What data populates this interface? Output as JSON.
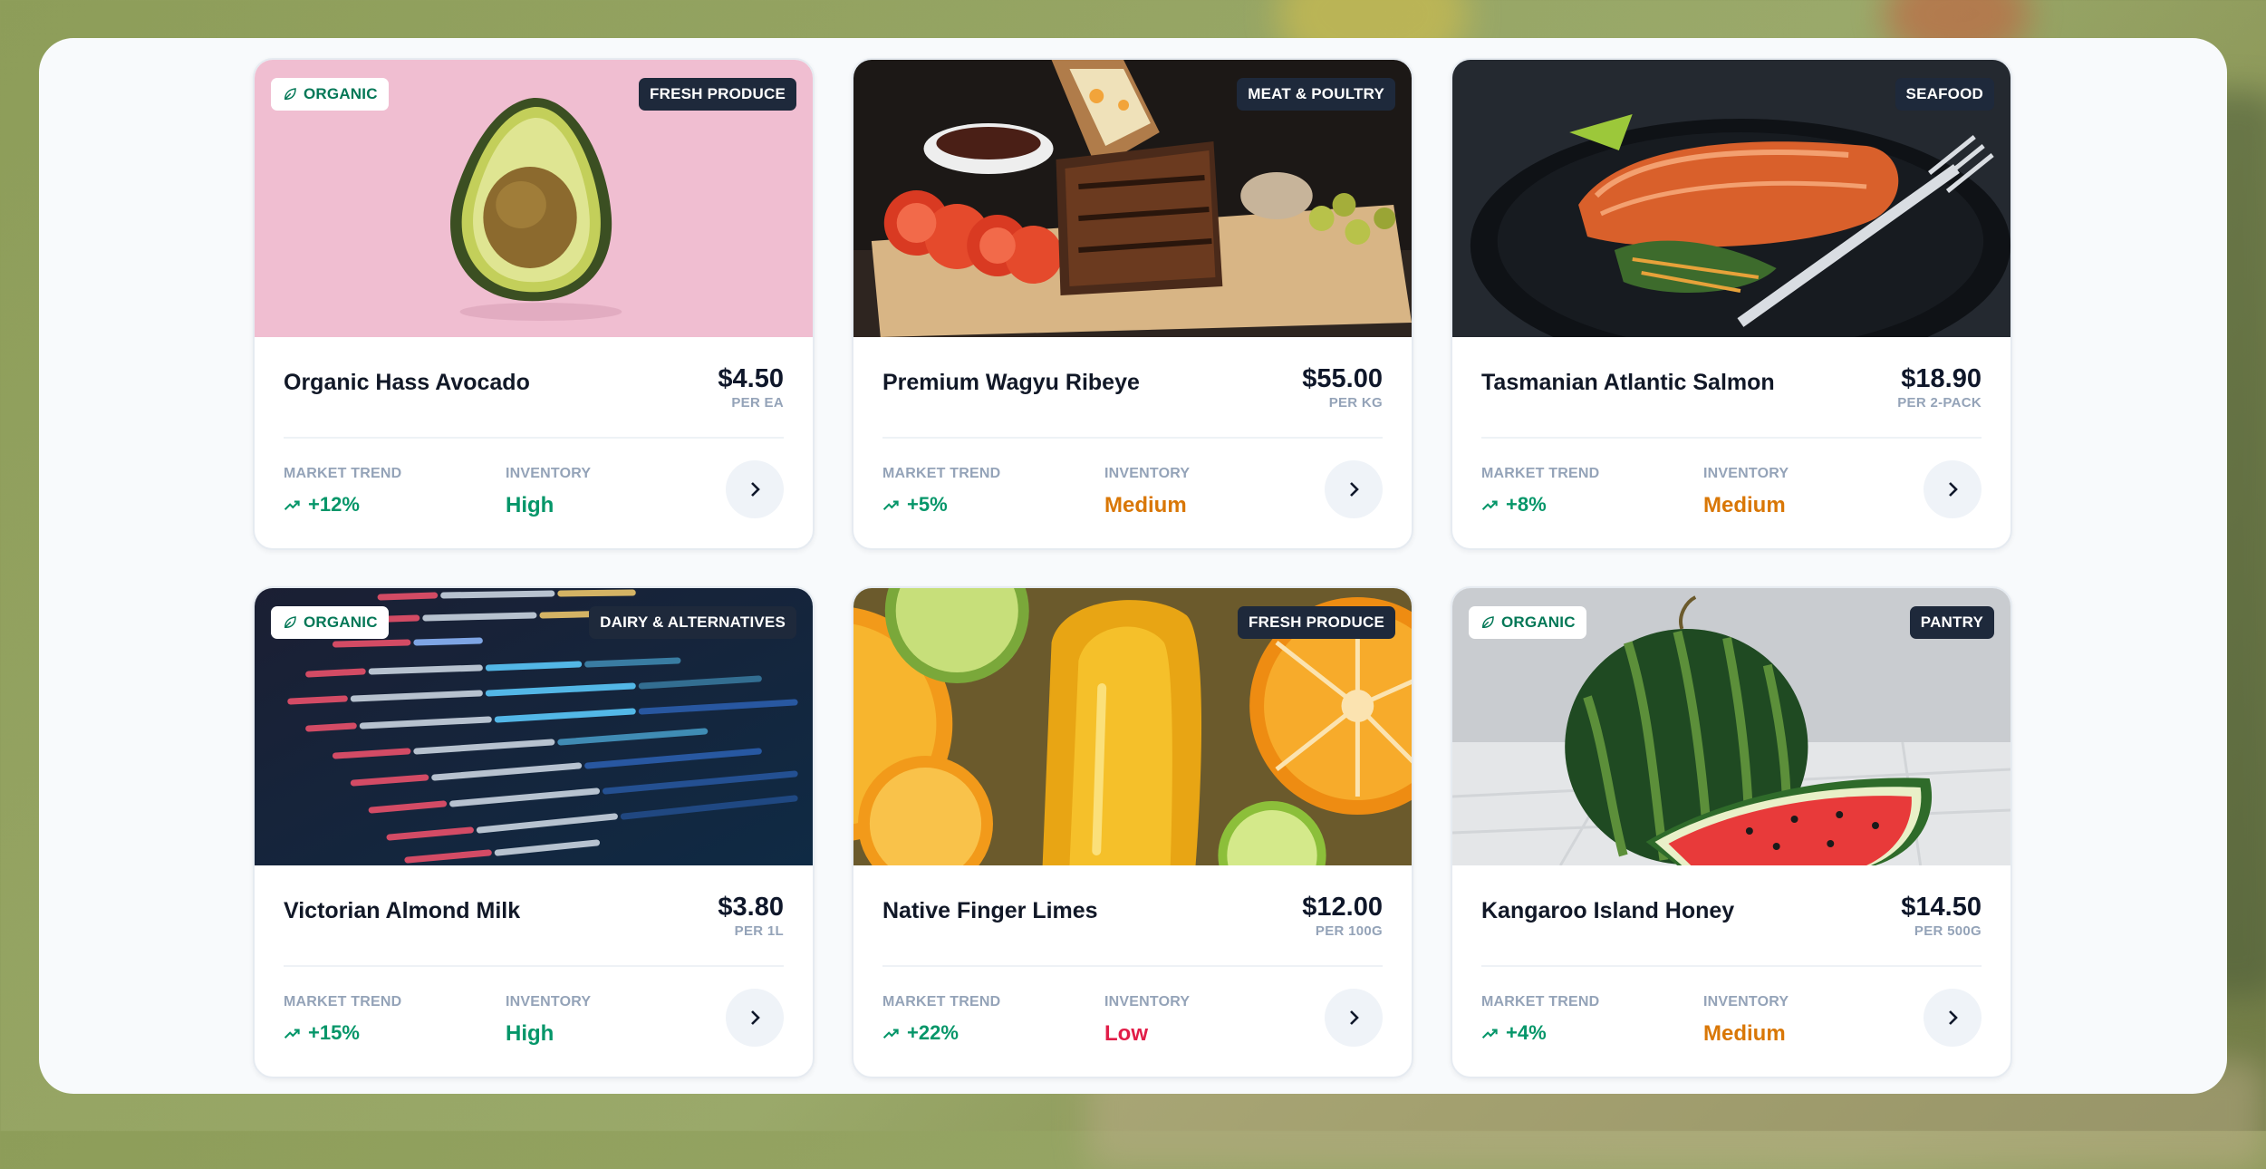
{
  "colors": {
    "panel_background": "#f8fafc",
    "category_badge": "#1e293b",
    "trend_positive": "#059669",
    "inventory_high": "#059669",
    "inventory_medium": "#d97706",
    "inventory_low": "#e11d48",
    "muted_label": "#94a3b8"
  },
  "labels": {
    "market_trend": "MARKET TREND",
    "inventory": "INVENTORY",
    "organic": "ORGANIC"
  },
  "icons": {
    "organic_badge": "leaf-icon",
    "trend": "trending-up-icon",
    "action": "chevron-right-icon"
  },
  "products": [
    {
      "name": "Organic Hass Avocado",
      "price": "$4.50",
      "unit": "PER EA",
      "category": "FRESH PRODUCE",
      "organic": true,
      "trend": "+12%",
      "inventory": "High",
      "inventory_color": "#059669",
      "image": "avocado"
    },
    {
      "name": "Premium Wagyu Ribeye",
      "price": "$55.00",
      "unit": "PER KG",
      "category": "MEAT & POULTRY",
      "organic": false,
      "trend": "+5%",
      "inventory": "Medium",
      "inventory_color": "#d97706",
      "image": "ribs-platter"
    },
    {
      "name": "Tasmanian Atlantic Salmon",
      "price": "$18.90",
      "unit": "PER 2-PACK",
      "category": "SEAFOOD",
      "organic": false,
      "trend": "+8%",
      "inventory": "Medium",
      "inventory_color": "#d97706",
      "image": "salmon-plate"
    },
    {
      "name": "Victorian Almond Milk",
      "price": "$3.80",
      "unit": "PER 1L",
      "category": "DAIRY & ALTERNATIVES",
      "organic": true,
      "trend": "+15%",
      "inventory": "High",
      "inventory_color": "#059669",
      "image": "code-screen"
    },
    {
      "name": "Native Finger Limes",
      "price": "$12.00",
      "unit": "PER 100G",
      "category": "FRESH PRODUCE",
      "organic": false,
      "trend": "+22%",
      "inventory": "Low",
      "inventory_color": "#e11d48",
      "image": "citrus-juice"
    },
    {
      "name": "Kangaroo Island Honey",
      "price": "$14.50",
      "unit": "PER 500G",
      "category": "PANTRY",
      "organic": true,
      "trend": "+4%",
      "inventory": "Medium",
      "inventory_color": "#d97706",
      "image": "watermelon"
    }
  ]
}
